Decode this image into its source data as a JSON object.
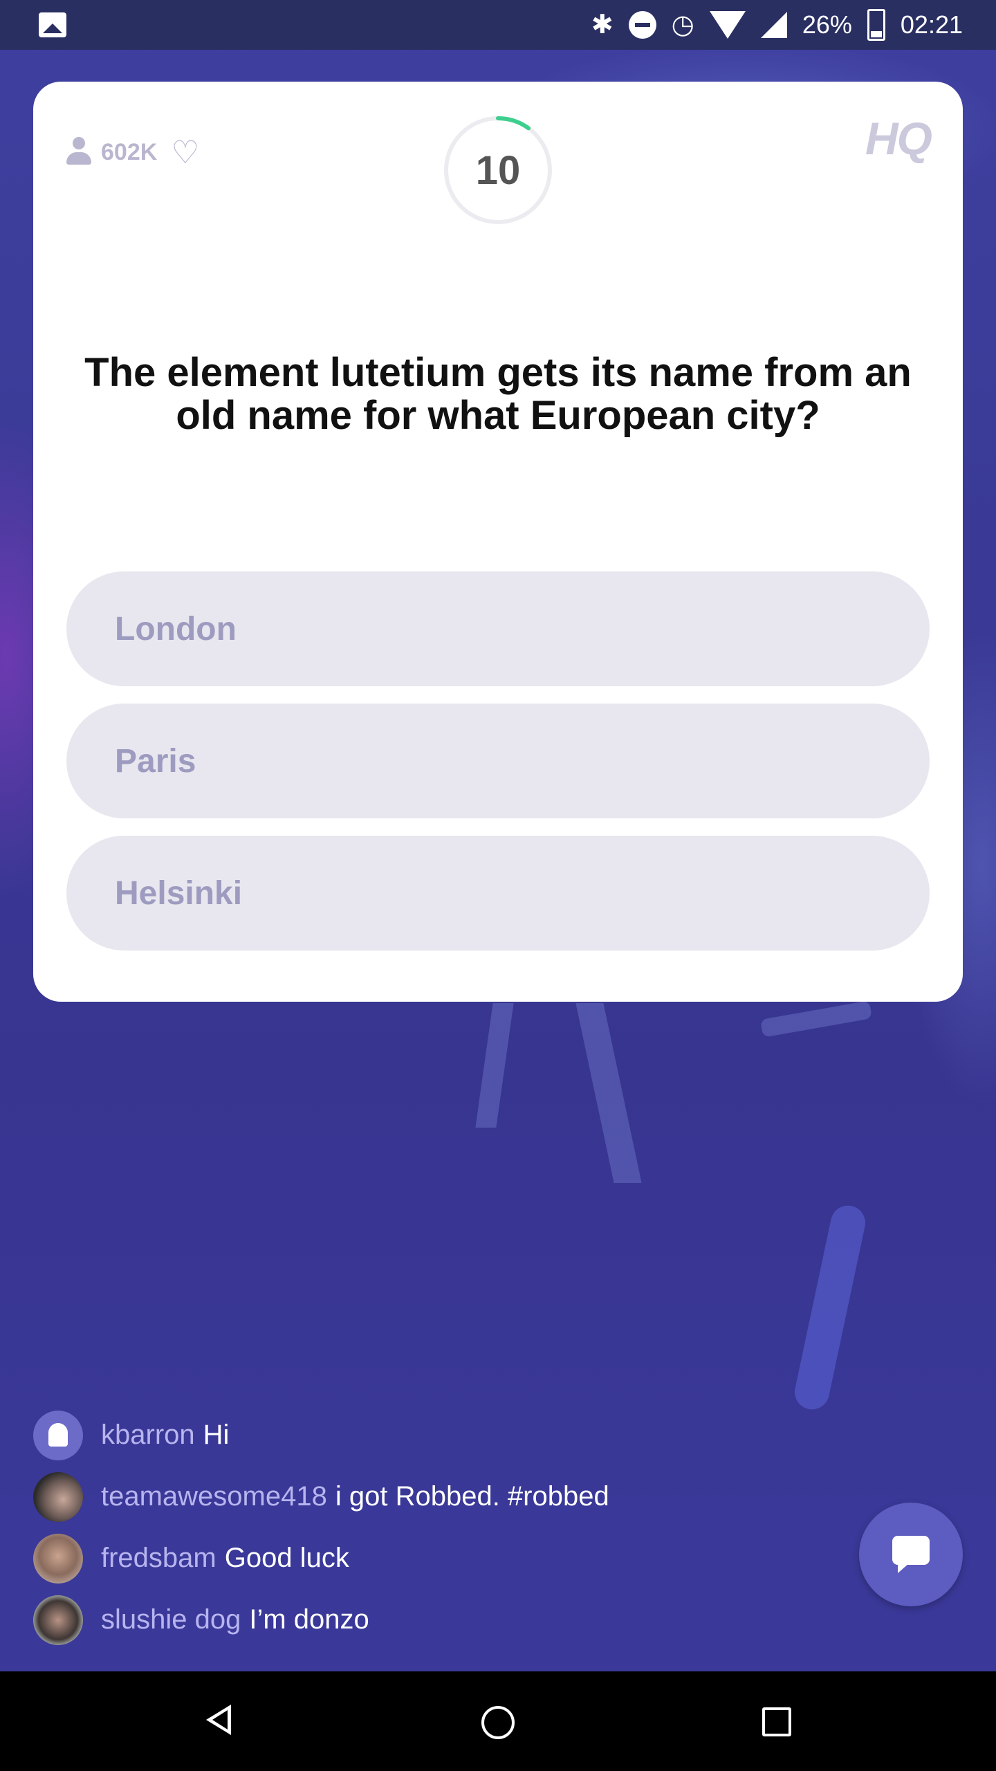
{
  "status_bar": {
    "battery": "26%",
    "time": "02:21",
    "icons": [
      "image-icon",
      "bluetooth-icon",
      "do-not-disturb-icon",
      "alarm-icon",
      "wifi-icon",
      "signal-icon",
      "battery-charging-icon"
    ]
  },
  "card": {
    "viewer_count": "602K",
    "timer": "10",
    "timer_progress": 0.1,
    "logo": "HQ",
    "question": "The element lutetium gets its name from an old name for what European city?",
    "answers": [
      "London",
      "Paris",
      "Helsinki"
    ]
  },
  "chat": {
    "messages": [
      {
        "user": "kbarron",
        "text": "Hi"
      },
      {
        "user": "teamawesome418",
        "text": "i got Robbed. #robbed"
      },
      {
        "user": "fredsbam",
        "text": "Good luck"
      },
      {
        "user": "slushie dog",
        "text": "I’m donzo"
      }
    ]
  },
  "colors": {
    "background": "#3a3a96",
    "card": "#ffffff",
    "answer_pill": "#e8e7ef",
    "answer_text": "#9d9bbf",
    "timer_accent": "#3ecf8e",
    "chat_username": "#b7b4ef",
    "chat_button": "#5d5cc0"
  }
}
